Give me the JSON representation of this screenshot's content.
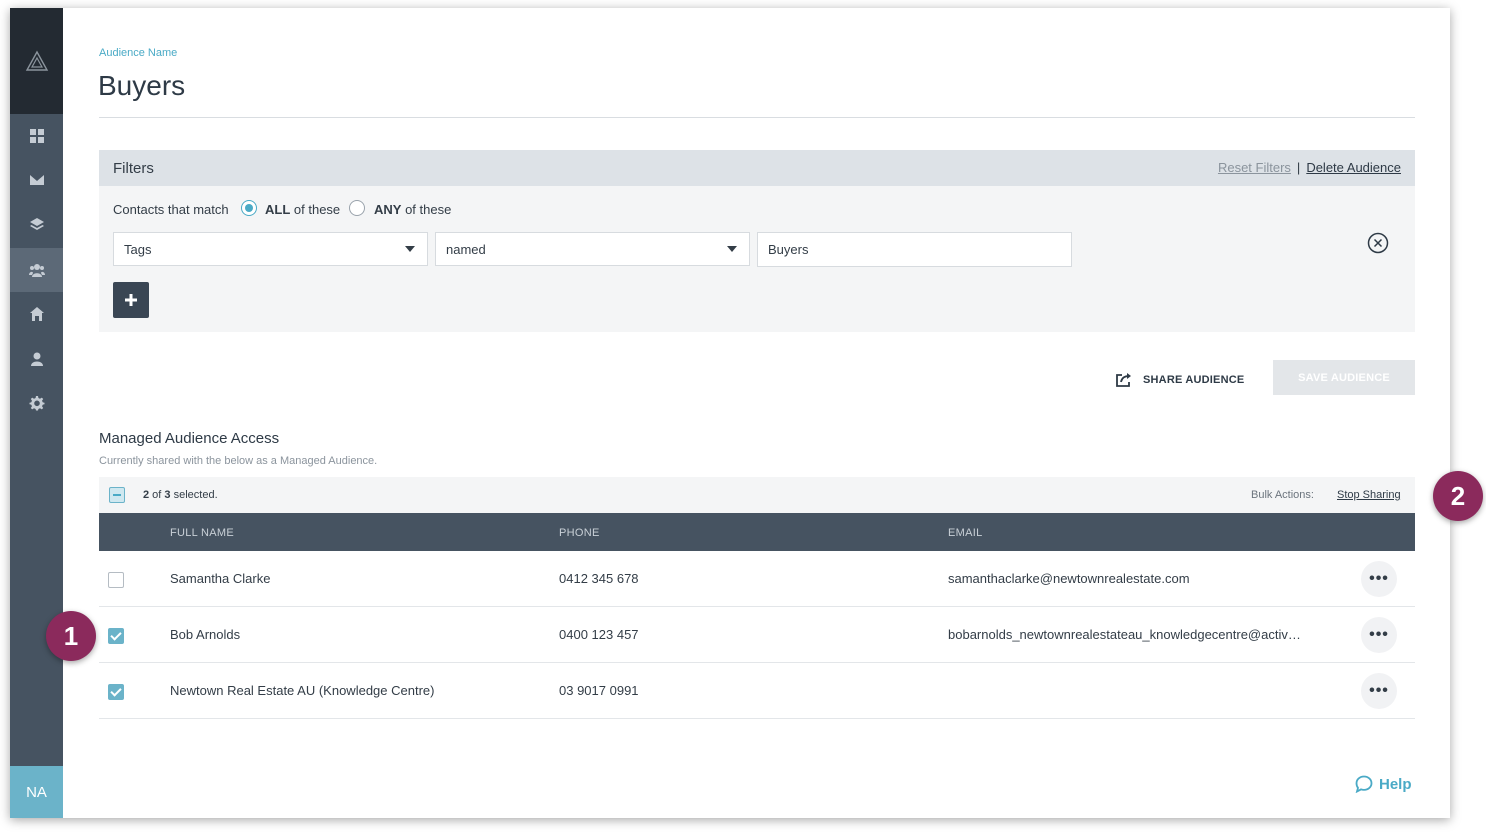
{
  "sidebar": {
    "logo": "triangle-logo",
    "items": [
      {
        "name": "dashboard",
        "icon": "grid-icon",
        "active": false
      },
      {
        "name": "email",
        "icon": "envelope-icon",
        "active": false
      },
      {
        "name": "layers",
        "icon": "layers-icon",
        "active": false
      },
      {
        "name": "audiences",
        "icon": "group-icon",
        "active": true
      },
      {
        "name": "properties",
        "icon": "home-icon",
        "active": false
      },
      {
        "name": "contacts",
        "icon": "person-icon",
        "active": false
      },
      {
        "name": "settings",
        "icon": "gear-icon",
        "active": false
      }
    ],
    "avatar": "NA"
  },
  "header": {
    "breadcrumb": "Audience Name",
    "title": "Buyers"
  },
  "filters": {
    "title": "Filters",
    "reset_label": "Reset Filters",
    "separator": "|",
    "delete_label": "Delete Audience",
    "match_label": "Contacts that match",
    "match_all_bold": "ALL",
    "match_all_rest": " of these",
    "match_any_bold": "ANY",
    "match_any_rest": " of these",
    "match_selected": "ALL",
    "rule": {
      "field": "Tags",
      "operator": "named",
      "value": "Buyers"
    },
    "add_label": "+"
  },
  "actions": {
    "share_label": "SHARE AUDIENCE",
    "save_label": "SAVE AUDIENCE"
  },
  "managed": {
    "title": "Managed Audience Access",
    "subtitle": "Currently shared with the below as a Managed Audience.",
    "bulk": {
      "selected": "2",
      "of_text": " of ",
      "total": "3",
      "suffix": " selected.",
      "label": "Bulk Actions:",
      "stop_label": "Stop Sharing"
    },
    "columns": [
      "FULL NAME",
      "PHONE",
      "EMAIL"
    ],
    "rows": [
      {
        "name": "Samantha Clarke",
        "phone": "0412 345 678",
        "email": "samanthaclarke@newtownrealestate.com",
        "checked": false
      },
      {
        "name": "Bob Arnolds",
        "phone": "0400 123 457",
        "email": "bobarnolds_newtownrealestateau_knowledgecentre@activepip...",
        "checked": true
      },
      {
        "name": "Newtown Real Estate AU (Knowledge Centre)",
        "phone": "03 9017 0991",
        "email": "",
        "checked": true
      }
    ],
    "more_label": "•••"
  },
  "help": {
    "label": "Help"
  },
  "callouts": [
    "1",
    "2"
  ],
  "colors": {
    "accent": "#4aaac6",
    "sidebar": "#465361",
    "callout": "#8b2a5c"
  }
}
